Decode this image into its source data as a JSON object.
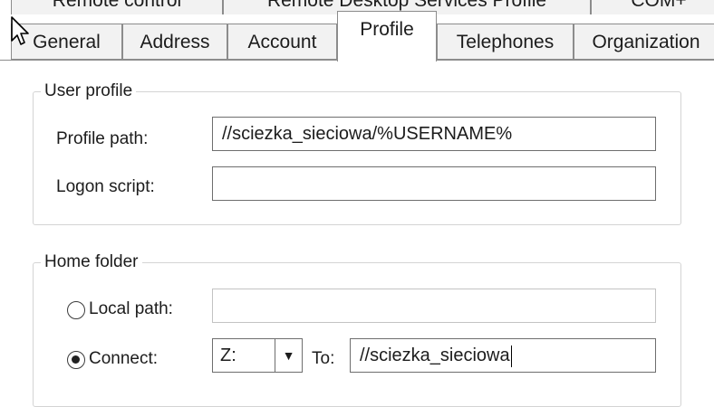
{
  "tabs_row1": [
    {
      "label": "Remote control"
    },
    {
      "label": "Remote Desktop Services Profile"
    },
    {
      "label": "COM+"
    }
  ],
  "tabs_row2": [
    {
      "label": "General"
    },
    {
      "label": "Address"
    },
    {
      "label": "Account"
    },
    {
      "label": "Profile",
      "active": true
    },
    {
      "label": "Telephones"
    },
    {
      "label": "Organization"
    }
  ],
  "user_profile": {
    "title": "User profile",
    "profile_path_label": "Profile path:",
    "profile_path_value": "//sciezka_sieciowa/%USERNAME%",
    "logon_script_label": "Logon script:",
    "logon_script_value": ""
  },
  "home_folder": {
    "title": "Home folder",
    "local_path_label": "Local path:",
    "local_path_value": "",
    "connect_label": "Connect:",
    "drive_value": "Z:",
    "to_label": "To:",
    "to_value": "//sciezka_sieciowa",
    "selected_option": "connect"
  },
  "icons": {
    "pointer": "mouse-pointer-icon",
    "dropdown": "chevron-down-icon"
  }
}
